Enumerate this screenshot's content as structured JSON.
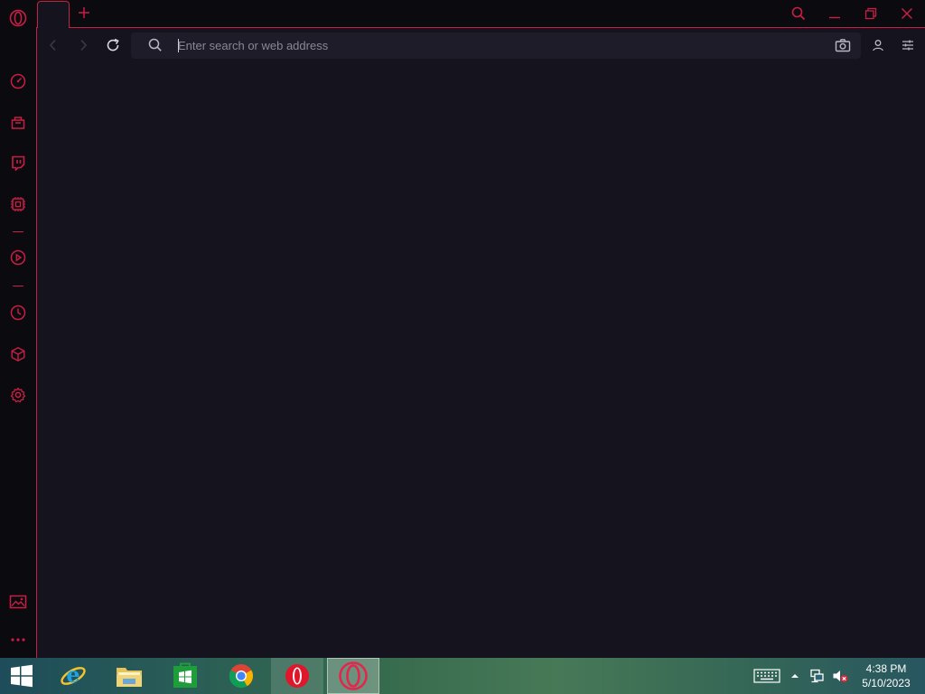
{
  "sidebar": {
    "items": [
      {
        "name": "opera-logo-icon"
      },
      {
        "name": "speed-dial-icon"
      },
      {
        "name": "shopping-icon"
      },
      {
        "name": "twitch-icon"
      },
      {
        "name": "gx-control-icon"
      },
      {
        "name": "player-icon"
      },
      {
        "name": "history-icon"
      },
      {
        "name": "extensions-icon"
      },
      {
        "name": "settings-icon"
      },
      {
        "name": "wallpaper-icon"
      },
      {
        "name": "more-icon"
      }
    ]
  },
  "toolbar": {
    "address_placeholder": "Enter search or web address",
    "address_value": ""
  },
  "colors": {
    "accent": "#c81e45",
    "background": "#15131d",
    "sidebar": "#0b0a0f",
    "addressbar": "#1f1c2a"
  },
  "taskbar": {
    "apps": [
      "Start",
      "Internet Explorer",
      "File Explorer",
      "Store",
      "Google Chrome",
      "Opera",
      "Opera GX"
    ],
    "tray": {
      "time": "4:38 PM",
      "date": "5/10/2023"
    }
  }
}
